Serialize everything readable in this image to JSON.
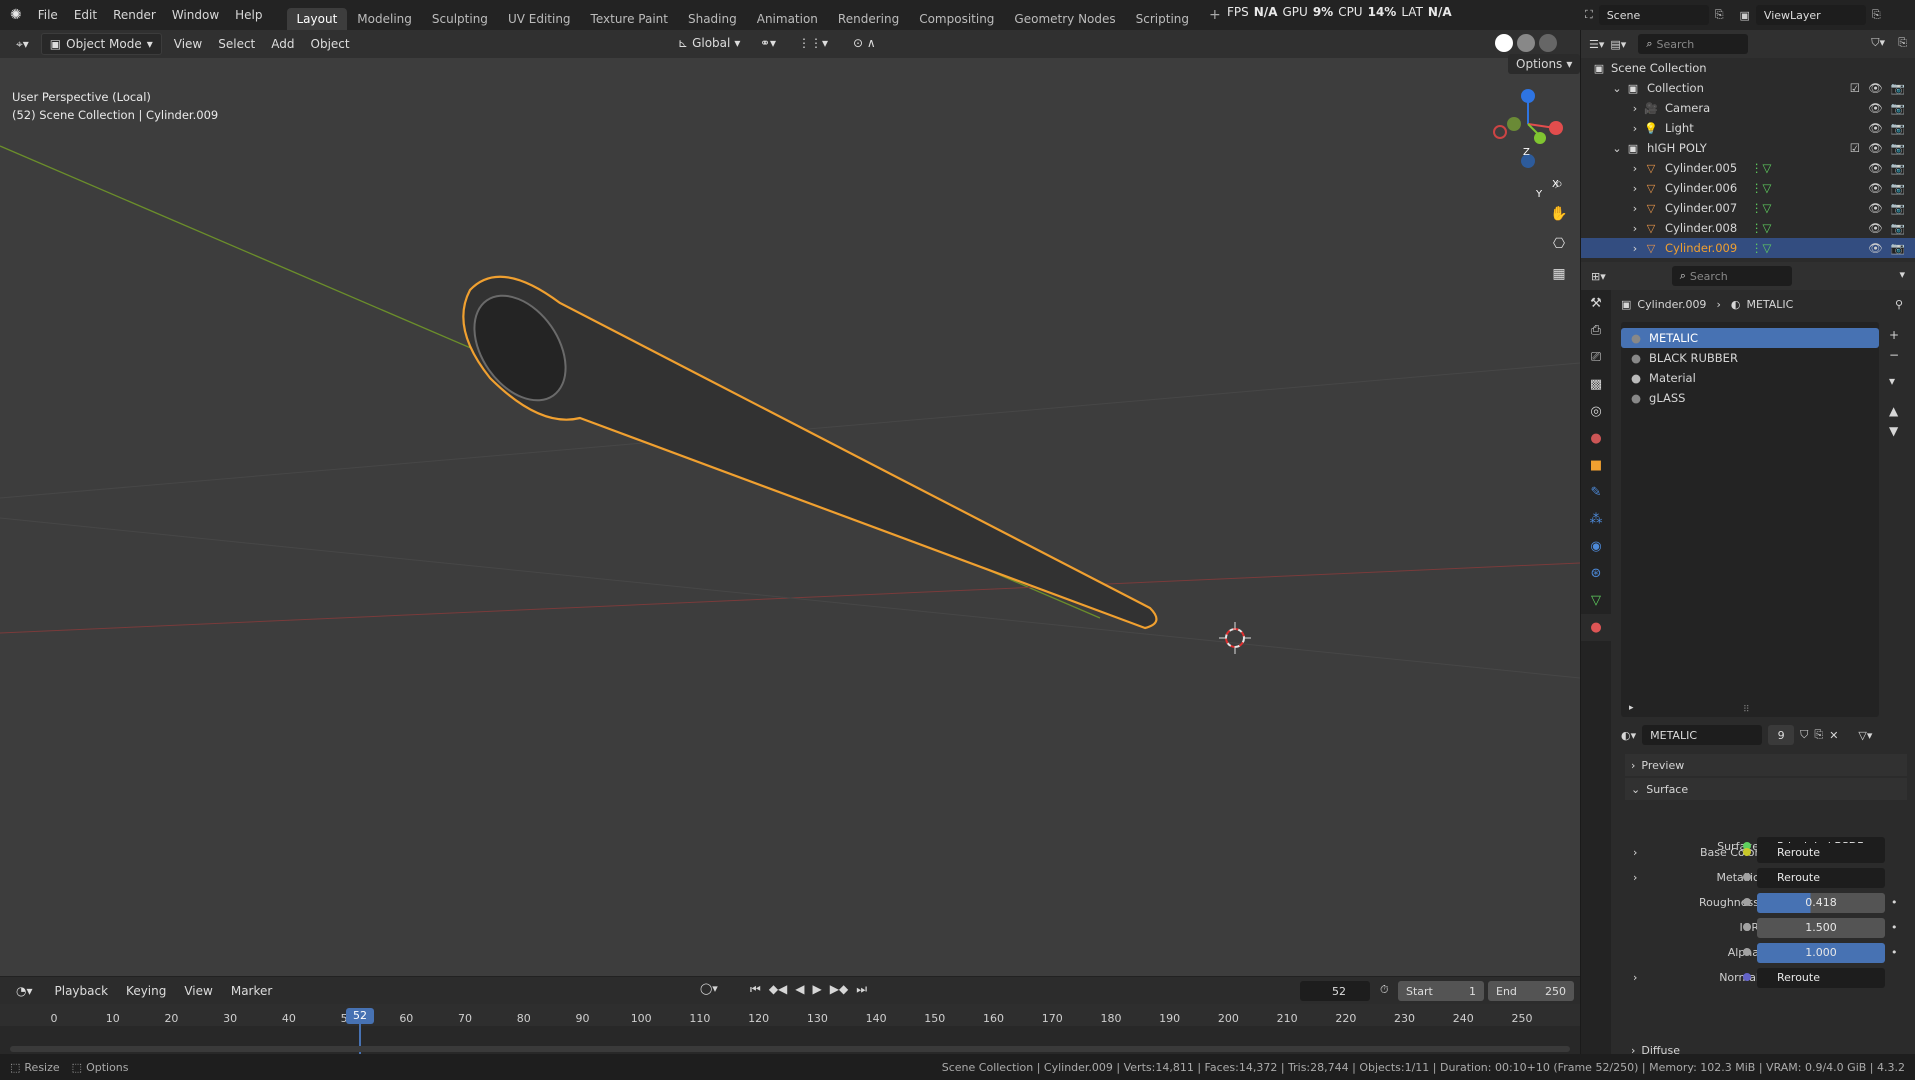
{
  "topbar": {
    "menus": [
      "File",
      "Edit",
      "Render",
      "Window",
      "Help"
    ],
    "workspaces": [
      "Layout",
      "Modeling",
      "Sculpting",
      "UV Editing",
      "Texture Paint",
      "Shading",
      "Animation",
      "Rendering",
      "Compositing",
      "Geometry Nodes",
      "Scripting"
    ],
    "active_workspace": "Layout",
    "scene": "Scene",
    "view_layer": "ViewLayer",
    "perf": {
      "fps_label": "FPS",
      "fps_value": "N/A",
      "gpu_label": "GPU",
      "gpu_value": "9%",
      "cpu_label": "CPU",
      "cpu_value": "14%",
      "lat_label": "LAT",
      "lat_value": "N/A"
    }
  },
  "viewport_header": {
    "mode": "Object Mode",
    "menus": [
      "View",
      "Select",
      "Add",
      "Object"
    ],
    "orientation": "Global",
    "options": "Options"
  },
  "viewport": {
    "perspective": "User Perspective (Local)",
    "context": "(52) Scene Collection | Cylinder.009",
    "axes": {
      "x": "X",
      "y": "Y",
      "z": "Z"
    }
  },
  "outliner": {
    "search_placeholder": "Search",
    "root": "Scene Collection",
    "items": [
      {
        "label": "Collection",
        "indent": 1,
        "type": "collection"
      },
      {
        "label": "Camera",
        "indent": 2,
        "type": "camera"
      },
      {
        "label": "Light",
        "indent": 2,
        "type": "light"
      },
      {
        "label": "hIGH POLY",
        "indent": 1,
        "type": "collection"
      },
      {
        "label": "Cylinder.005",
        "indent": 2,
        "type": "mesh"
      },
      {
        "label": "Cylinder.006",
        "indent": 2,
        "type": "mesh"
      },
      {
        "label": "Cylinder.007",
        "indent": 2,
        "type": "mesh"
      },
      {
        "label": "Cylinder.008",
        "indent": 2,
        "type": "mesh"
      },
      {
        "label": "Cylinder.009",
        "indent": 2,
        "type": "mesh",
        "selected": true
      }
    ]
  },
  "properties": {
    "search_placeholder": "Search",
    "breadcrumb_object": "Cylinder.009",
    "breadcrumb_material": "METALIC",
    "slots": [
      "METALIC",
      "BLACK RUBBER",
      "Material",
      "gLASS"
    ],
    "active_material": "METALIC",
    "user_count": "9",
    "panels": {
      "preview": "Preview",
      "surface": "Surface",
      "diffuse": "Diffuse"
    },
    "surface_label": "Surface",
    "surface_value": "Principled BSDF",
    "rows": [
      {
        "label": "Base Color",
        "value": "Reroute",
        "kind": "link",
        "dot": "#c7c729"
      },
      {
        "label": "Metallic",
        "value": "Reroute",
        "kind": "link",
        "dot": "#a1a1a1"
      },
      {
        "label": "Roughness",
        "value": "0.418",
        "kind": "slider",
        "dot": "#a1a1a1",
        "fill": 0.418
      },
      {
        "label": "IOR",
        "value": "1.500",
        "kind": "num",
        "dot": "#a1a1a1"
      },
      {
        "label": "Alpha",
        "value": "1.000",
        "kind": "slider",
        "dot": "#a1a1a1",
        "fill": 1.0
      },
      {
        "label": "Normal",
        "value": "Reroute",
        "kind": "link",
        "dot": "#6363c7"
      }
    ]
  },
  "timeline": {
    "menus": [
      "Playback",
      "Keying",
      "View",
      "Marker"
    ],
    "current_frame": "52",
    "start_label": "Start",
    "start": "1",
    "end_label": "End",
    "end": "250",
    "ticks": [
      0,
      10,
      20,
      30,
      40,
      50,
      60,
      70,
      80,
      90,
      100,
      110,
      120,
      130,
      140,
      150,
      160,
      170,
      180,
      190,
      200,
      210,
      220,
      230,
      240,
      250
    ]
  },
  "statusbar": {
    "left": [
      "Resize",
      "Options"
    ],
    "right": "Scene Collection | Cylinder.009 | Verts:14,811 | Faces:14,372 | Tris:28,744 | Objects:1/11 | Duration: 00:10+10 (Frame 52/250) | Memory: 102.3 MiB | VRAM: 0.9/4.0 GiB | 4.3.2"
  },
  "colors": {
    "accent": "#4772b3",
    "selection": "#e89a2e",
    "x_axis": "#e24d4d",
    "y_axis": "#80c531",
    "z_axis": "#2e74e2"
  }
}
